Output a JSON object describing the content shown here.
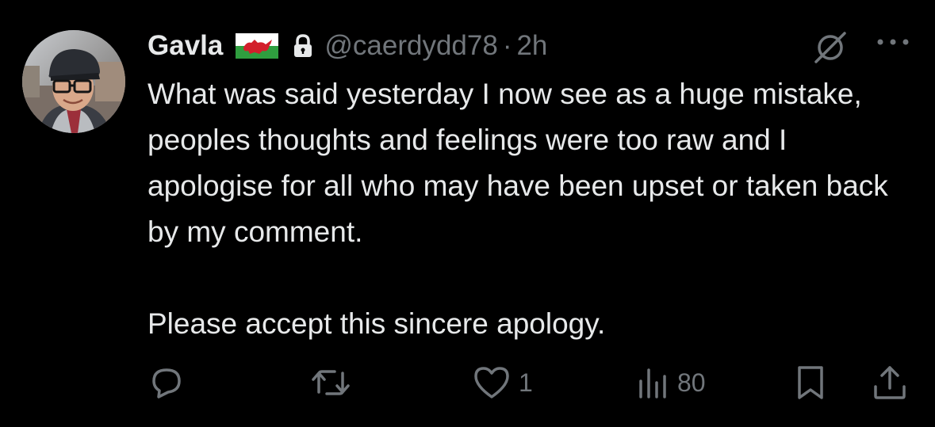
{
  "tweet": {
    "display_name": "Gavla",
    "handle": "@caerdydd78",
    "separator": "·",
    "timestamp": "2h",
    "flag_icon": "wales-flag-icon",
    "lock_icon": "lock-icon",
    "text_paragraph_1": "What was said yesterday I now see as a huge mistake, peoples thoughts and feelings were too raw and I apologise for all who may have been upset or taken back by my comment.",
    "text_paragraph_2": "Please accept this sincere apology."
  },
  "actions": {
    "reply_icon": "reply-icon",
    "retweet_icon": "retweet-icon",
    "like_icon": "heart-icon",
    "like_count": "1",
    "views_icon": "views-icon",
    "view_count": "80",
    "bookmark_icon": "bookmark-icon",
    "share_icon": "share-icon"
  },
  "colors": {
    "background": "#000000",
    "primary_text": "#e7e9ea",
    "secondary_text": "#71767b",
    "flag_green": "#2f9e3f",
    "flag_red": "#d21f2b"
  }
}
